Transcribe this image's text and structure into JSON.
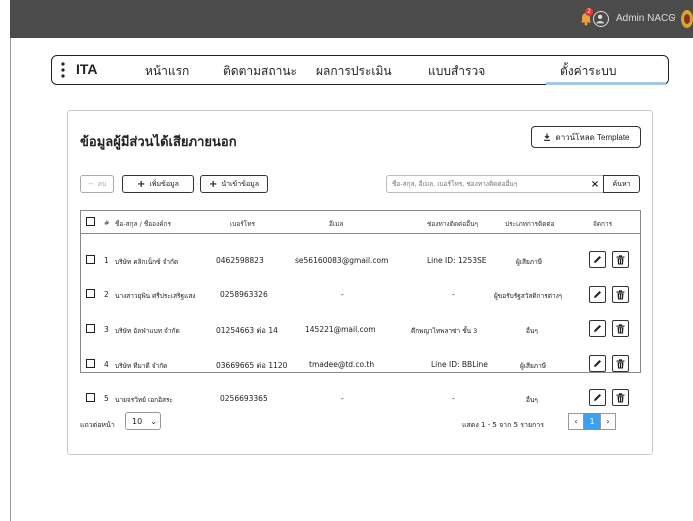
{
  "topbar": {
    "notification_count": "2",
    "admin_name": "Admin NACC"
  },
  "nav": {
    "brand": "ITA",
    "items": [
      "หน้าแรก",
      "ติดตามสถานะ",
      "ผลการประเมิน",
      "แบบสำรวจ",
      "ตั้งค่าระบบ"
    ],
    "active_index": 4
  },
  "page": {
    "title": "ข้อมูลผู้มีส่วนได้เสียภายนอก",
    "download_label": "ดาวน์โหลด Template"
  },
  "toolbar": {
    "delete_label": "ลบ",
    "add_label": "เพิ่มข้อมูล",
    "import_label": "นำเข้าข้อมูล",
    "search_placeholder": "ชื่อ-สกุล, อีเมล, เบอร์โทร, ช่องทางติดต่ออื่นๆ",
    "search_button": "ค้นหา"
  },
  "table": {
    "headers": {
      "no": "#",
      "name": "ชื่อ-สกุล / ชื่อองค์กร",
      "phone": "เบอร์โทร",
      "email": "อีเมล",
      "other": "ช่องทางติดต่ออื่นๆ",
      "type": "ประเภทการติดต่อ",
      "actions": "จัดการ"
    },
    "rows": [
      {
        "no": "1",
        "name": "บริษัท คลิกเน็กซ์ จำกัด",
        "phone": "0462598823",
        "email": "se56160083@gmail.com",
        "other": "Line ID: 1253SE",
        "type": "ผู้เสียภาษี"
      },
      {
        "no": "2",
        "name": "นางสาวยุพิน ศรีประเสริฐแสง",
        "phone": "0258963326",
        "email": "-",
        "other": "-",
        "type": "ผู้ขอรับรัฐสวัสดิการต่างๆ"
      },
      {
        "no": "3",
        "name": "บริษัท อัลฟ่าแบท จำกัด",
        "phone": "01254663 ต่อ 14",
        "email": "145221@mail.com",
        "other": "ตึกพญาไทพลาซ่า ชั้น 3",
        "type": "อื่นๆ"
      },
      {
        "no": "4",
        "name": "บริษัท ทีมาดี จำกัด",
        "phone": "03669665 ต่อ 1120",
        "email": "tmadee@td.co.th",
        "other": "Line ID: BBLine",
        "type": "ผู้เสียภาษี"
      },
      {
        "no": "5",
        "name": "นายจรวิทย์ เอกอิสระ",
        "phone": "0256693365",
        "email": "-",
        "other": "-",
        "type": "อื่นๆ"
      }
    ]
  },
  "footer": {
    "rows_per_page_label": "แถวต่อหน้า",
    "rows_per_page": "10",
    "page_info": "แสดง 1 - 5 จาก 5 รายการ",
    "current_page": "1",
    "prev": "‹",
    "next": "›"
  },
  "colors": {
    "topbar": "#4b4b4b",
    "accent": "#3aa0f2",
    "tab_underline": "#a7c7e7"
  }
}
